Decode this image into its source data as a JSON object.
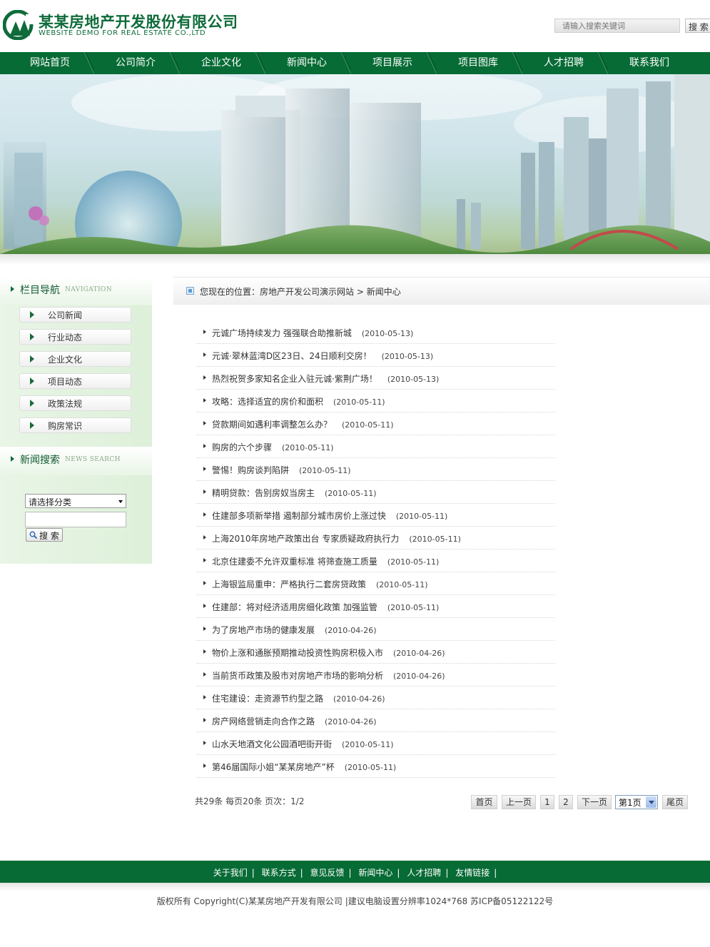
{
  "header": {
    "logo_cn": "某某房地产开发股份有限公司",
    "logo_en": "WEBSITE DEMO FOR REAL ESTATE CO.,LTD",
    "search_placeholder": "请输入搜索关键词",
    "search_button": "搜 索",
    "brand_color": "#066b35"
  },
  "nav": [
    "网站首页",
    "公司简介",
    "企业文化",
    "新闻中心",
    "项目展示",
    "项目图库",
    "人才招聘",
    "联系我们"
  ],
  "sidebar": {
    "nav_title": "栏目导航",
    "nav_title_en": "NAVIGATION",
    "items": [
      "公司新闻",
      "行业动态",
      "企业文化",
      "项目动态",
      "政策法规",
      "购房常识"
    ],
    "search_title": "新闻搜索",
    "search_title_en": "NEWS SEARCH",
    "category_selected": "请选择分类",
    "search_button": "搜 索"
  },
  "breadcrumb": {
    "label": "您现在的位置：",
    "site": "房地产开发公司演示网站",
    "sep": " > ",
    "current": "新闻中心"
  },
  "news": [
    {
      "title": "元诚广场持续发力 强强联合助推新城",
      "date": "(2010-05-13)"
    },
    {
      "title": "元诚·翠林蓝湾D区23日、24日顺利交房！",
      "date": "(2010-05-13)"
    },
    {
      "title": "热烈祝贺多家知名企业入驻元诚·紫荆广场！",
      "date": "(2010-05-13)"
    },
    {
      "title": "攻略：选择适宜的房价和面积",
      "date": "(2010-05-11)"
    },
    {
      "title": "贷款期间如遇利率调整怎么办？",
      "date": "(2010-05-11)"
    },
    {
      "title": "购房的六个步骤",
      "date": "(2010-05-11)"
    },
    {
      "title": "警惕！购房谈判陷阱",
      "date": "(2010-05-11)"
    },
    {
      "title": "精明贷款：告别房奴当房主",
      "date": "(2010-05-11)"
    },
    {
      "title": "住建部多项新举措 遏制部分城市房价上涨过快",
      "date": "(2010-05-11)"
    },
    {
      "title": "上海2010年房地产政策出台 专家质疑政府执行力",
      "date": "(2010-05-11)"
    },
    {
      "title": "北京住建委不允许双重标准 将筛查施工质量",
      "date": "(2010-05-11)"
    },
    {
      "title": "上海银监局重申：严格执行二套房贷政策",
      "date": "(2010-05-11)"
    },
    {
      "title": "住建部：将对经济适用房细化政策 加强监管",
      "date": "(2010-05-11)"
    },
    {
      "title": "为了房地产市场的健康发展",
      "date": "(2010-04-26)"
    },
    {
      "title": "物价上涨和通胀预期推动投资性购房积极入市",
      "date": "(2010-04-26)"
    },
    {
      "title": "当前货币政策及股市对房地产市场的影响分析",
      "date": "(2010-04-26)"
    },
    {
      "title": "住宅建设：走资源节约型之路",
      "date": "(2010-04-26)"
    },
    {
      "title": "房产网络营销走向合作之路",
      "date": "(2010-04-26)"
    },
    {
      "title": "山水天地酒文化公园酒吧街开街",
      "date": "(2010-05-11)"
    },
    {
      "title": "第46届国际小姐“某某房地产”杯",
      "date": "(2010-05-11)"
    }
  ],
  "pagination": {
    "info": "共29条  每页20条  页次：1/2",
    "first": "首页",
    "prev": "上一页",
    "page1": "1",
    "page2": "2",
    "next": "下一页",
    "jump_selected": "第1页",
    "last": "尾页"
  },
  "footer": {
    "links": [
      "关于我们",
      "联系方式",
      "意见反馈",
      "新闻中心",
      "人才招聘",
      "友情链接"
    ],
    "sep": "|",
    "copyright": "版权所有  Copyright(C)某某房地产开发有限公司  |建议电脑设置分辨率1024*768 苏ICP备05122122号"
  }
}
